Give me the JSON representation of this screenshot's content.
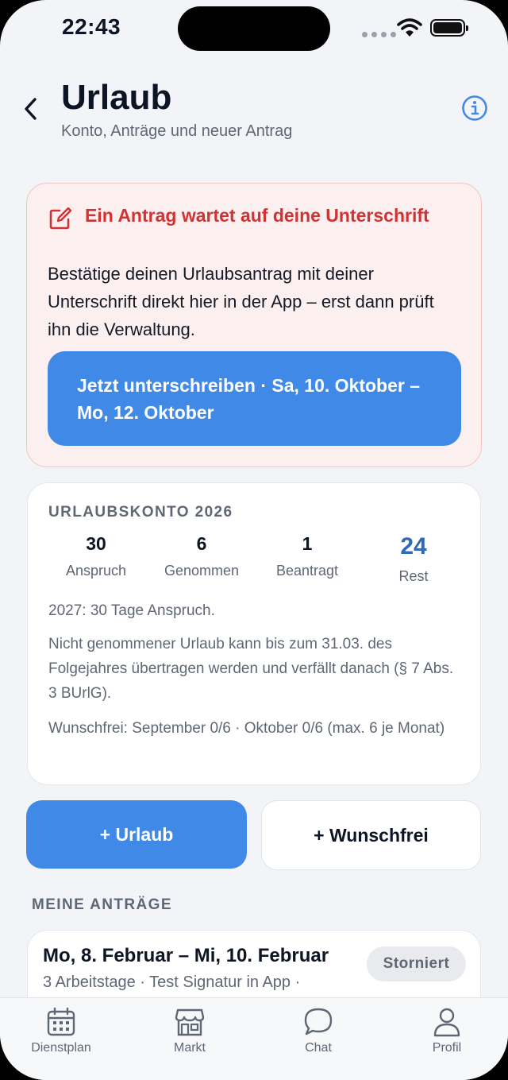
{
  "status": {
    "time": "22:43"
  },
  "header": {
    "title": "Urlaub",
    "subtitle": "Konto, Anträge und neuer Antrag"
  },
  "signature": {
    "title": "Ein Antrag wartet auf deine Unterschrift",
    "text": "Bestätige deinen Urlaubsantrag mit deiner Unterschrift direkt hier in der App – erst dann prüft ihn die Verwaltung.",
    "button": "Jetzt unterschreiben · Sa, 10. Oktober – Mo, 12. Oktober"
  },
  "account": {
    "heading": "URLAUBSKONTO 2026",
    "stats": [
      {
        "value": "30",
        "label": "Anspruch"
      },
      {
        "value": "6",
        "label": "Genommen"
      },
      {
        "value": "1",
        "label": "Beantragt"
      },
      {
        "value": "24",
        "label": "Rest"
      }
    ],
    "next_year": "2027: 30 Tage Anspruch.",
    "carryover": "Nicht genommener Urlaub kann bis zum 31.03. des Folgejahres übertragen werden und verfällt danach (§ 7 Abs. 3 BUrlG).",
    "wunschfrei": "Wunschfrei: September 0/6 · Oktober 0/6 (max. 6 je Monat)"
  },
  "actions": {
    "urlaub": "+ Urlaub",
    "wunschfrei": "+ Wunschfrei"
  },
  "requests": {
    "heading": "MEINE ANTRÄGE",
    "items": [
      {
        "title": "Mo, 8. Februar – Mi, 10. Februar",
        "sub": "3 Arbeitstage · Test Signatur in App ·",
        "status": "Storniert"
      }
    ]
  },
  "tabs": [
    {
      "label": "Dienstplan",
      "icon": "calendar-icon"
    },
    {
      "label": "Markt",
      "icon": "store-icon"
    },
    {
      "label": "Chat",
      "icon": "chat-bubble-icon"
    },
    {
      "label": "Profil",
      "icon": "person-icon"
    }
  ],
  "colors": {
    "primary": "#4189e6",
    "alert": "#cf3434",
    "alert_bg": "#fcefef",
    "rest_value": "#2f6ab8"
  }
}
